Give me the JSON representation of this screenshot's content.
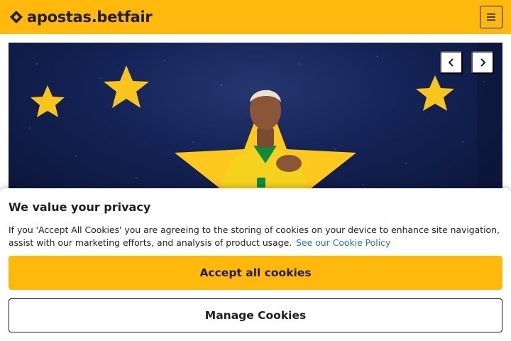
{
  "header": {
    "logo_text": "apostas.betfair",
    "logo_icon": "betfair-logo-icon",
    "menu_icon": "hamburger-menu-icon",
    "background_color": "#ffb80c"
  },
  "hero": {
    "image_description_icon": "footballer-promo-image",
    "prev_icon": "chevron-left-icon",
    "next_icon": "chevron-right-icon"
  },
  "cookie_banner": {
    "title": "We value your privacy",
    "body": "If you 'Accept All Cookies' you are agreeing to the storing of cookies on your device to enhance site navigation, assist with our marketing efforts, and analysis of product usage.",
    "policy_link": "See our Cookie Policy",
    "accept_label": "Accept all cookies",
    "manage_label": "Manage Cookies",
    "accent_color": "#ffb80c",
    "link_color": "#1a73c9"
  }
}
